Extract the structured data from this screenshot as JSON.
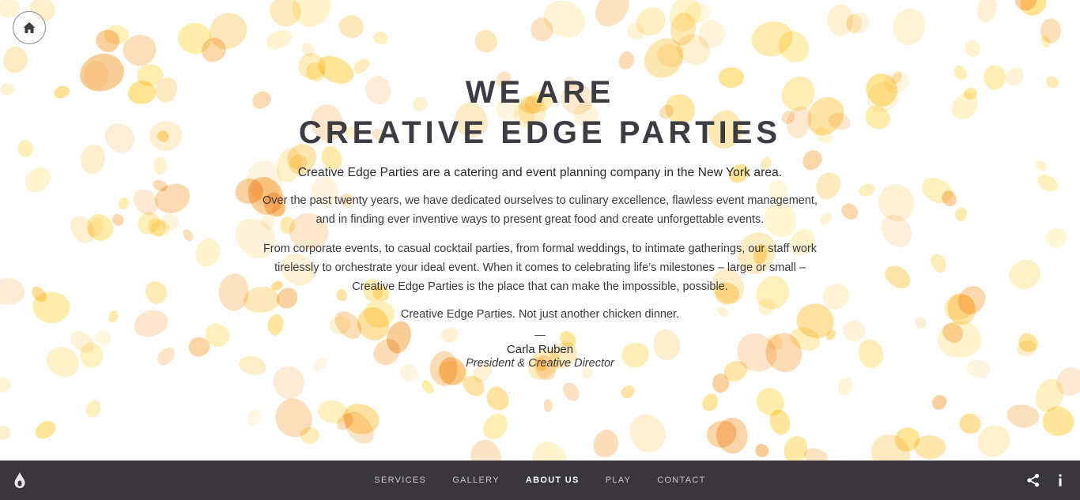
{
  "header": {
    "home_icon": "home-icon"
  },
  "hero": {
    "headline_line1": "WE ARE",
    "headline_line2": "CREATIVE EDGE PARTIES",
    "intro": "Creative Edge Parties are a catering and event planning company in the New York area.",
    "paragraph1": "Over the past twenty years, we have dedicated ourselves to culinary excellence, flawless event management, and in finding ever inventive ways to present great food and create unforgettable events.",
    "paragraph2": "From corporate events, to casual cocktail parties, from formal weddings, to intimate gatherings, our staff work tirelessly to orchestrate your ideal event. When it comes to celebrating life’s milestones – large or small – Creative Edge Parties is the place that can make the impossible, possible.",
    "tagline": "Creative Edge Parties. Not just another chicken dinner.",
    "signature_dash": "—",
    "signature_name": "Carla Ruben",
    "signature_title": "President & Creative Director"
  },
  "footer": {
    "logo_icon": "drop-logo-icon",
    "nav": [
      {
        "label": "SERVICES"
      },
      {
        "label": "GALLERY"
      },
      {
        "label": "ABOUT US"
      },
      {
        "label": "PLAY"
      },
      {
        "label": "CONTACT"
      }
    ],
    "active_nav": "ABOUT US",
    "share_icon": "share-icon",
    "info_icon": "info-icon"
  },
  "colors": {
    "footer_bg": "#3a373c",
    "headline": "#3d3c42",
    "petal_yellow": "#ffd24a",
    "petal_orange": "#f7b25a"
  }
}
